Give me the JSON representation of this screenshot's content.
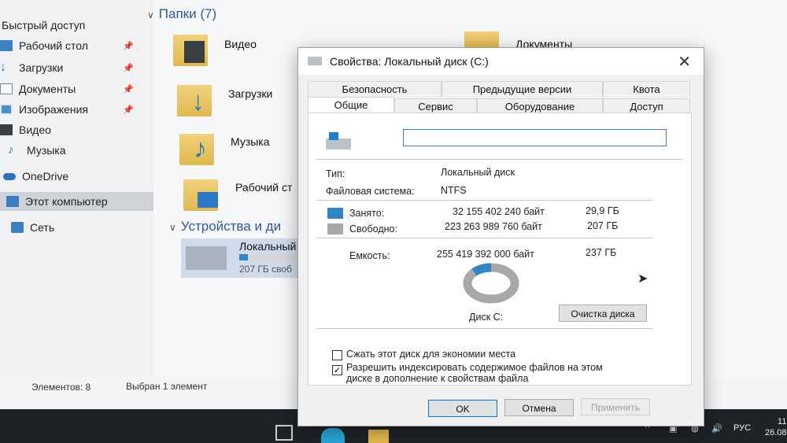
{
  "explorer": {
    "nav": {
      "items": [
        {
          "label": "Быстрый доступ"
        },
        {
          "label": "Рабочий стол",
          "pinned": true
        },
        {
          "label": "Загрузки",
          "pinned": true
        },
        {
          "label": "Документы",
          "pinned": true
        },
        {
          "label": "Изображения",
          "pinned": true
        },
        {
          "label": "Видео"
        },
        {
          "label": "Музыка"
        },
        {
          "label": "OneDrive"
        },
        {
          "label": "Этот компьютер",
          "selected": true
        },
        {
          "label": "Сеть"
        }
      ]
    },
    "folders_header": "Папки (7)",
    "folders": [
      {
        "label": "Видео"
      },
      {
        "label": "Загрузки"
      },
      {
        "label": "Музыка"
      },
      {
        "label": "Рабочий ст"
      },
      {
        "label": "Документы"
      }
    ],
    "devices_header": "Устройства и ди",
    "drive": {
      "label": "Локальный",
      "free": "207 ГБ своб"
    },
    "status": {
      "items_count": "Элементов: 8",
      "selected": "Выбран 1 элемент"
    }
  },
  "dialog": {
    "title": "Свойства: Локальный диск (C:)",
    "tabs_row1": [
      "Безопасность",
      "Предыдущие версии",
      "Квота"
    ],
    "tabs_row2": [
      "Общие",
      "Сервис",
      "Оборудование",
      "Доступ"
    ],
    "active_tab": "Общие",
    "name_value": "",
    "type_label": "Тип:",
    "type_value": "Локальный диск",
    "fs_label": "Файловая система:",
    "fs_value": "NTFS",
    "used_label": "Занято:",
    "used_bytes": "32 155 402 240 байт",
    "used_gb": "29,9 ГБ",
    "free_label": "Свободно:",
    "free_bytes": "223 263 989 760 байт",
    "free_gb": "207 ГБ",
    "capacity_label": "Емкость:",
    "capacity_bytes": "255 419 392 000 байт",
    "capacity_gb": "237 ГБ",
    "disk_label": "Диск C:",
    "cleanup_button": "Очистка диска",
    "compress_label": "Сжать этот диск для экономии места",
    "compress_checked": false,
    "index_label_line1": "Разрешить индексировать содержимое файлов на этом",
    "index_label_line2": "диске в дополнение к свойствам файла",
    "index_checked": true,
    "ok_button": "OK",
    "cancel_button": "Отмена",
    "apply_button": "Применить",
    "used_fraction": 0.126,
    "colors": {
      "used": "#2e86c9",
      "free": "#a8a8a8"
    }
  },
  "taskbar": {
    "language": "РУС",
    "date": "26.08",
    "time": "11"
  }
}
